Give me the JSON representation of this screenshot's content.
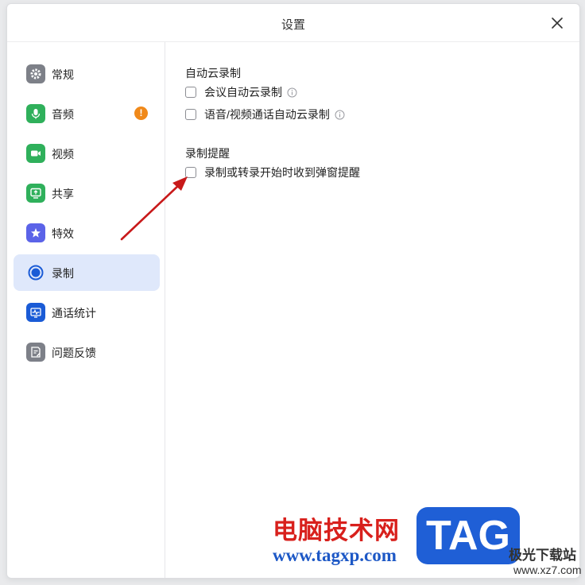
{
  "window": {
    "title": "设置"
  },
  "sidebar": {
    "items": [
      {
        "label": "常规",
        "icon": "gear-icon",
        "color": "#7d8088"
      },
      {
        "label": "音频",
        "icon": "microphone-icon",
        "color": "#2fb05b",
        "badge": "!"
      },
      {
        "label": "视频",
        "icon": "video-camera-icon",
        "color": "#2fb05b"
      },
      {
        "label": "共享",
        "icon": "share-screen-icon",
        "color": "#2fb05b"
      },
      {
        "label": "特效",
        "icon": "magic-effect-icon",
        "color": "#5b63e8"
      },
      {
        "label": "录制",
        "icon": "record-icon",
        "color": "#1a5bd6",
        "active": true
      },
      {
        "label": "通话统计",
        "icon": "call-statistics-icon",
        "color": "#1a5bd6"
      },
      {
        "label": "问题反馈",
        "icon": "feedback-icon",
        "color": "#7d8088"
      }
    ]
  },
  "content": {
    "auto_cloud_record": {
      "title": "自动云录制",
      "options": [
        {
          "label": "会议自动云录制",
          "checked": false,
          "info": true
        },
        {
          "label": "语音/视频通话自动云录制",
          "checked": false,
          "info": true
        }
      ]
    },
    "record_reminder": {
      "title": "录制提醒",
      "options": [
        {
          "label": "录制或转录开始时收到弹窗提醒",
          "checked": false
        }
      ]
    }
  },
  "watermark": {
    "brand": "电脑技术网",
    "url": "www.tagxp.com",
    "logo": "TAG",
    "site": "极光下载站",
    "site_url": "www.xz7.com"
  },
  "colors": {
    "accent": "#1a5bd6",
    "active_bg": "#dfe8fb",
    "warning": "#f0891a",
    "arrow": "#c8191a"
  }
}
